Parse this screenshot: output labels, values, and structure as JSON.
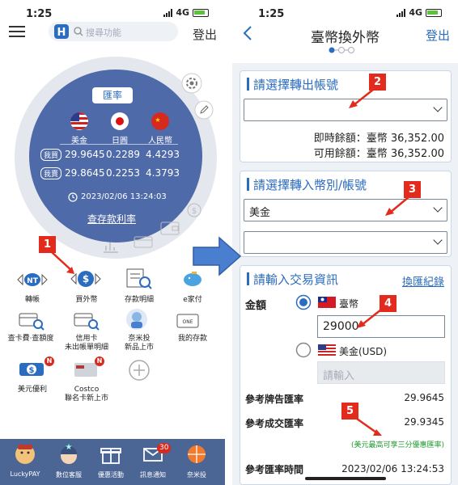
{
  "left": {
    "status": {
      "time": "1:25",
      "network": "4G"
    },
    "search_placeholder": "搜尋功能",
    "logout": "登出",
    "rates": {
      "badge": "匯率",
      "currencies": [
        "美金",
        "日圓",
        "人民幣"
      ],
      "rows": [
        {
          "label": "我買",
          "values": [
            "29.9645",
            "0.2289",
            "4.4293"
          ]
        },
        {
          "label": "我賣",
          "values": [
            "29.8645",
            "0.2253",
            "4.3793"
          ]
        }
      ],
      "timestamp": "2023/02/06 13:24:03",
      "deposit_link": "查存款利率"
    },
    "grid": [
      {
        "label": "轉帳",
        "icon": "nt-transfer-icon"
      },
      {
        "label": "買外幣",
        "icon": "dollar-exchange-icon"
      },
      {
        "label": "存款明細",
        "icon": "statement-search-icon"
      },
      {
        "label": "e家付",
        "icon": "piggy-bank-icon"
      },
      {
        "label": "查卡費‧查額度",
        "icon": "card-search-icon"
      },
      {
        "label": "信用卡\n未出帳單明細",
        "icon": "card-bill-icon"
      },
      {
        "label": "奈米投\n新品上市",
        "icon": "nano-invest-icon"
      },
      {
        "label": "我的存款",
        "icon": "my-deposit-icon"
      },
      {
        "label": "美元優利",
        "icon": "usd-bonus-icon"
      },
      {
        "label": "Costco\n聯名卡新上市",
        "icon": "costco-card-icon"
      },
      {
        "label": "",
        "icon": "add-icon"
      }
    ],
    "new_badge": "N",
    "bottom": [
      {
        "label": "LuckyPAY",
        "icon": "luckypay-icon"
      },
      {
        "label": "數位客服",
        "icon": "service-icon"
      },
      {
        "label": "優惠活動",
        "icon": "gift-icon"
      },
      {
        "label": "訊息通知",
        "icon": "mail-icon",
        "badge": "30"
      },
      {
        "label": "奈米投",
        "icon": "nano-icon"
      }
    ]
  },
  "right": {
    "status": {
      "time": "1:25",
      "network": "4G"
    },
    "title": "臺幣換外幣",
    "logout": "登出",
    "sec1": {
      "title": "請選擇轉出帳號",
      "instant_balance_label": "即時餘額：",
      "instant_balance": "臺幣 36,352.00",
      "available_balance_label": "可用餘額：",
      "available_balance": "臺幣 36,352.00"
    },
    "sec2": {
      "title": "請選擇轉入幣別/帳號",
      "currency": "美金"
    },
    "sec3": {
      "title": "請輸入交易資訊",
      "history_link": "換匯紀錄",
      "amount_label": "金額",
      "twd_label": "臺幣",
      "amount_value": "29000",
      "usd_label": "美金(USD)",
      "usd_placeholder": "請輸入",
      "rows": [
        {
          "label": "參考牌告匯率",
          "value": "29.9645"
        },
        {
          "label": "參考成交匯率",
          "value": "29.9345"
        }
      ],
      "discount_note": "(美元最高可享三分優惠匯率)",
      "rate_time_label": "參考匯率時間",
      "rate_time": "2023/02/06 13:24:53"
    }
  },
  "markers": [
    "1",
    "2",
    "3",
    "4",
    "5"
  ],
  "colors": {
    "primary": "#2a6cbf",
    "circle": "#4f6aa8",
    "marker": "#e32b1d",
    "bottombar": "#4b6594",
    "arrow": "#4a7fd0"
  }
}
